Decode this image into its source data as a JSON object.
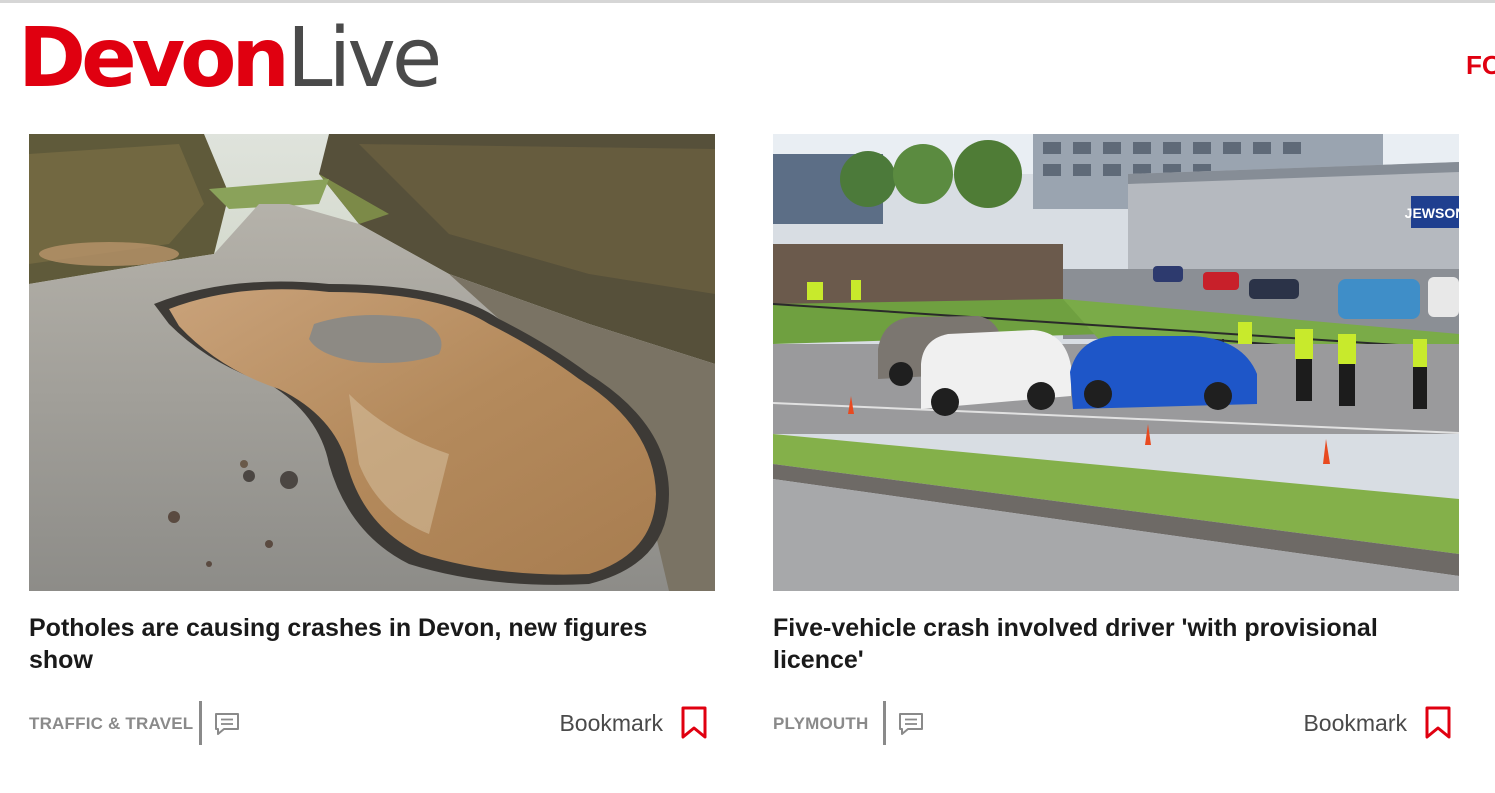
{
  "header": {
    "logo_primary": "Devon",
    "logo_secondary": "Live",
    "nav_cut_text": "FO",
    "brand_color": "#e00010"
  },
  "articles": [
    {
      "image_icon": "pothole-road-photo",
      "headline": "Potholes are causing crashes in Devon, new figures show",
      "category": "TRAFFIC & TRAVEL",
      "comment_icon": "comment-icon",
      "bookmark_label": "Bookmark",
      "bookmark_icon": "bookmark-icon"
    },
    {
      "image_icon": "car-crash-road-photo",
      "headline": "Five-vehicle crash involved driver 'with provisional licence'",
      "category": "PLYMOUTH",
      "comment_icon": "comment-icon",
      "bookmark_label": "Bookmark",
      "bookmark_icon": "bookmark-icon",
      "sign_text": "JEWSON"
    }
  ]
}
